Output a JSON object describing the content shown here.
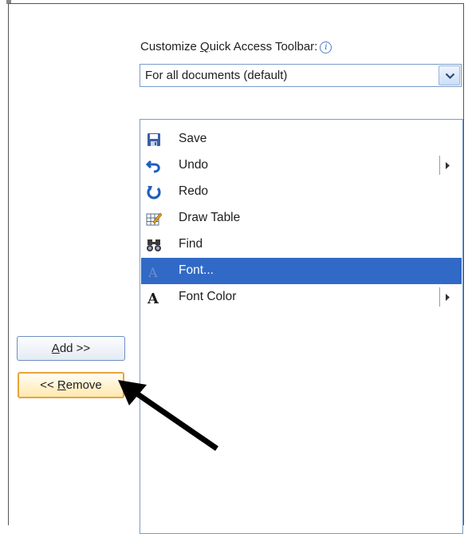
{
  "label": {
    "before": "Customize ",
    "accel": "Q",
    "after": "uick Access Toolbar:",
    "info_glyph": "i"
  },
  "scope_select": {
    "value": "For all documents (default)"
  },
  "toolbar_items": [
    {
      "label": "Save",
      "icon": "save-icon",
      "has_submenu": false,
      "selected": false
    },
    {
      "label": "Undo",
      "icon": "undo-icon",
      "has_submenu": true,
      "selected": false
    },
    {
      "label": "Redo",
      "icon": "redo-icon",
      "has_submenu": false,
      "selected": false
    },
    {
      "label": "Draw Table",
      "icon": "draw-table-icon",
      "has_submenu": false,
      "selected": false
    },
    {
      "label": "Find",
      "icon": "binoculars-icon",
      "has_submenu": false,
      "selected": false
    },
    {
      "label": "Font...",
      "icon": "font-icon",
      "has_submenu": false,
      "selected": true
    },
    {
      "label": "Font Color",
      "icon": "font-color-icon",
      "has_submenu": true,
      "selected": false
    }
  ],
  "buttons": {
    "add_accel": "A",
    "add_rest": "dd >>",
    "remove_prefix": "<< ",
    "remove_accel": "R",
    "remove_rest": "emove"
  },
  "colors": {
    "selection": "#3169c6",
    "remove_focus": "#e7a43a",
    "border": "#7a9cc8"
  }
}
